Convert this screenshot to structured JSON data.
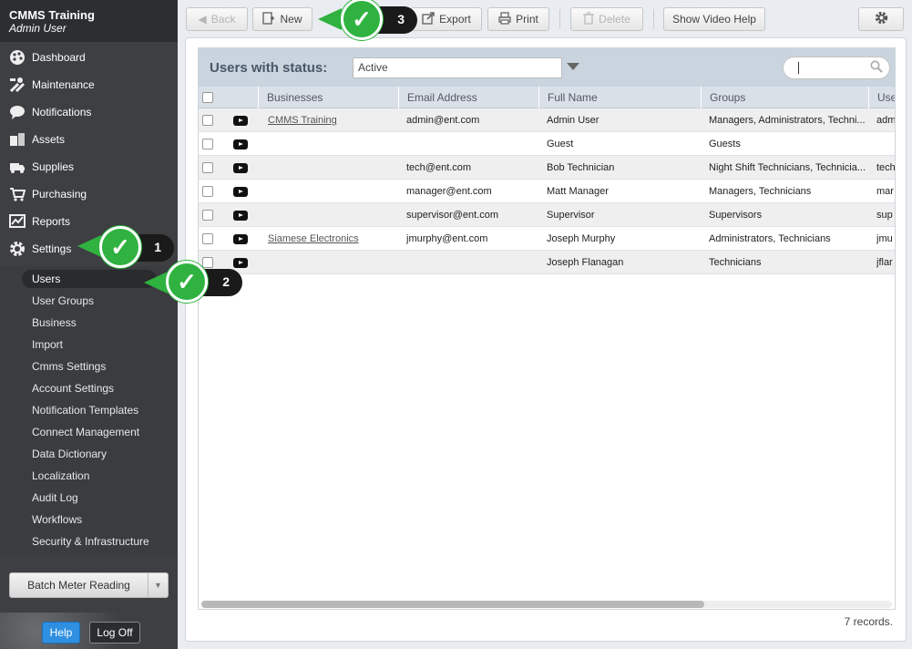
{
  "sidebar": {
    "app_name": "CMMS Training",
    "user_name": "Admin User",
    "nav": [
      {
        "label": "Dashboard",
        "icon": "palette-icon"
      },
      {
        "label": "Maintenance",
        "icon": "tools-icon"
      },
      {
        "label": "Notifications",
        "icon": "chat-bubble-icon"
      },
      {
        "label": "Assets",
        "icon": "boxes-icon"
      },
      {
        "label": "Supplies",
        "icon": "truck-icon"
      },
      {
        "label": "Purchasing",
        "icon": "cart-icon"
      },
      {
        "label": "Reports",
        "icon": "chart-icon"
      },
      {
        "label": "Settings",
        "icon": "gear-icon"
      }
    ],
    "settings_items": [
      "Users",
      "User Groups",
      "Business",
      "Import",
      "Cmms Settings",
      "Account Settings",
      "Notification Templates",
      "Connect Management",
      "Data Dictionary",
      "Localization",
      "Audit Log",
      "Workflows",
      "Security & Infrastructure"
    ],
    "active_item": "Users",
    "batch_button": "Batch Meter Reading",
    "help_button": "Help",
    "logoff_button": "Log Off"
  },
  "toolbar": {
    "back": "Back",
    "new": "New",
    "export": "Export",
    "print": "Print",
    "delete": "Delete",
    "video_help": "Show Video Help"
  },
  "grid": {
    "title": "Users with status:",
    "status_value": "Active",
    "search_value": "",
    "columns": [
      "Businesses",
      "Email Address",
      "Full Name",
      "Groups",
      "Use"
    ],
    "rows": [
      {
        "business": "CMMS Training",
        "email": "admin@ent.com",
        "name": "Admin User",
        "groups": "Managers, Administrators, Techni...",
        "user": "adm"
      },
      {
        "business": "",
        "email": "",
        "name": "Guest",
        "groups": "Guests",
        "user": ""
      },
      {
        "business": "",
        "email": "tech@ent.com",
        "name": "Bob Technician",
        "groups": "Night Shift Technicians, Technicia...",
        "user": "tech"
      },
      {
        "business": "",
        "email": "manager@ent.com",
        "name": "Matt Manager",
        "groups": "Managers, Technicians",
        "user": "mar"
      },
      {
        "business": "",
        "email": "supervisor@ent.com",
        "name": "Supervisor",
        "groups": "Supervisors",
        "user": "sup"
      },
      {
        "business": "Siamese Electronics",
        "email": "jmurphy@ent.com",
        "name": "Joseph Murphy",
        "groups": "Administrators, Technicians",
        "user": "jmu"
      },
      {
        "business": "",
        "email": "",
        "name": "Joseph Flanagan",
        "groups": "Technicians",
        "user": "jflar"
      }
    ],
    "records_label": "7 records."
  },
  "callouts": [
    "1",
    "2",
    "3"
  ],
  "colors": {
    "sidebar": "#3d3f42",
    "accent_green": "#2fb240",
    "grid_header": "#c9d4df"
  }
}
